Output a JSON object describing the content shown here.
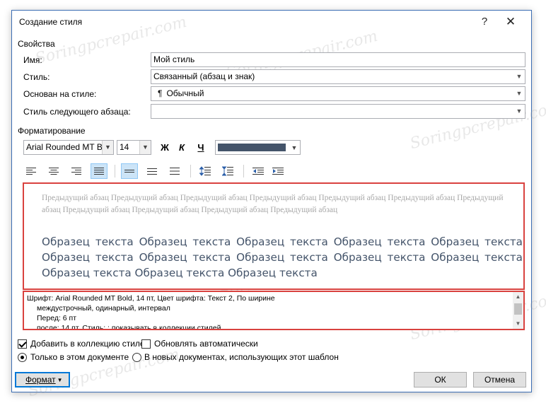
{
  "window": {
    "title": "Создание стиля",
    "help": "?",
    "close": "✕"
  },
  "properties": {
    "section": "Свойства",
    "name_label": "Имя:",
    "name_value": "Мой стиль",
    "type_label": "Стиль:",
    "type_value": "Связанный (абзац и знак)",
    "based_label": "Основан на стиле:",
    "based_icon": "¶",
    "based_value": "Обычный",
    "next_label": "Стиль следующего абзаца:",
    "next_value": ""
  },
  "formatting": {
    "section": "Форматирование",
    "font": "Arial Rounded MT Bold",
    "size": "14",
    "bold": "Ж",
    "italic": "К",
    "underline": "Ч",
    "font_color": "#44546a"
  },
  "preview": {
    "previous_text": "Предыдущий абзац Предыдущий абзац Предыдущий абзац Предыдущий абзац Предыдущий абзац Предыдущий абзац Предыдущий абзац Предыдущий абзац Предыдущий абзац Предыдущий абзац Предыдущий абзац",
    "sample_text": "Образец текста Образец текста Образец текста Образец текста Образец текста Образец текста Образец текста Образец текста Образец текста Образец текста Образец текста Образец текста Образец текста"
  },
  "description": {
    "line1": "Шрифт: Arial Rounded MT Bold, 14 пт, Цвет шрифта: Текст 2, По ширине",
    "line2": "междустрочный,  одинарный, интервал",
    "line3": "Перед:  6 пт",
    "line4": "после: 14 пт, Стиль: : показывать в коллекции стилей"
  },
  "options": {
    "add_to_gallery": "Добавить в коллекцию стилей",
    "add_to_gallery_checked": true,
    "auto_update": "Обновлять автоматически",
    "auto_update_checked": false,
    "only_this_doc": "Только в этом документе",
    "new_docs": "В новых документах, использующих этот шаблон",
    "selected_scope": "only_this_doc"
  },
  "buttons": {
    "format": "Формат",
    "ok": "ОК",
    "cancel": "Отмена"
  },
  "watermark": "Soringpcrepair.com"
}
